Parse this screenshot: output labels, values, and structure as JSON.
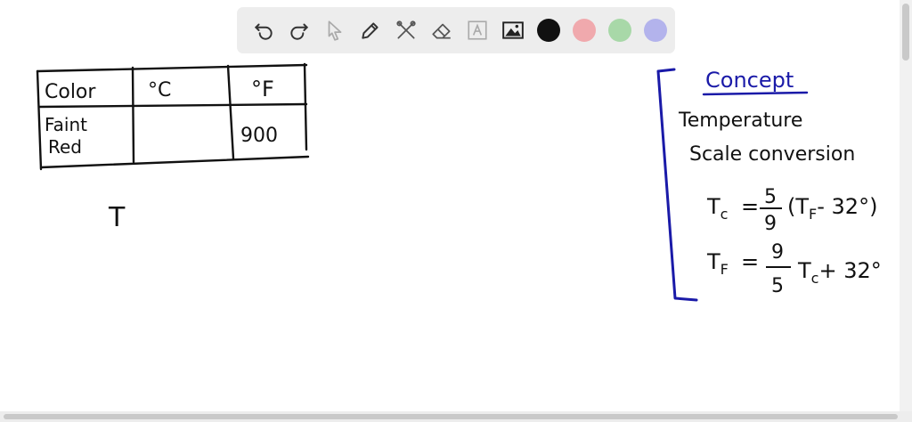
{
  "toolbar": {
    "tools": [
      "undo-icon",
      "redo-icon",
      "pointer-icon",
      "pen-icon",
      "tools-icon",
      "eraser-icon",
      "text-icon",
      "image-icon"
    ],
    "colors": [
      "#111111",
      "#f0a9ad",
      "#a8d8a8",
      "#b3b3ec"
    ]
  },
  "table": {
    "headers": [
      "Color",
      "°C",
      "°F"
    ],
    "row_label_line1": "Faint",
    "row_label_line2": "Red",
    "celsius": "",
    "fahrenheit": "900"
  },
  "work": {
    "t_label": "T"
  },
  "concept": {
    "title": "Concept",
    "line1": "Temperature",
    "line2": "Scale conversion",
    "f1_lhs": "T",
    "f1_lhs_sub": "c",
    "f1_num": "5",
    "f1_den": "9",
    "f1_rhs_open": "(T",
    "f1_rhs_sub": "F",
    "f1_rhs_tail": "- 32°)",
    "f2_lhs": "T",
    "f2_lhs_sub": "F",
    "f2_num": "9",
    "f2_den": "5",
    "f2_rhs": "T",
    "f2_rhs_sub": "c",
    "f2_rhs_tail": "+ 32°"
  },
  "accent_color": "#1a1aa8"
}
